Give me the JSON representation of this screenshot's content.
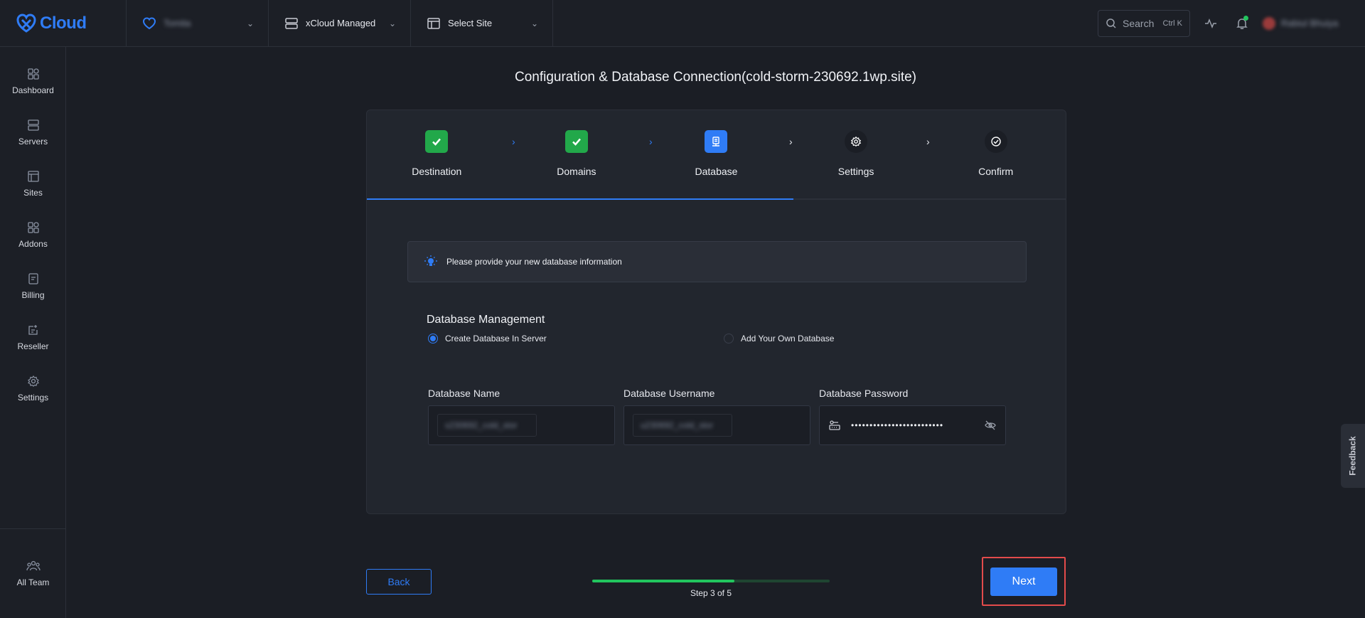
{
  "brand": {
    "logo_text": "Cloud",
    "accent": "#2f7cf6"
  },
  "topbar": {
    "team_crumb": "Tomita",
    "managed_crumb": "xCloud Managed",
    "site_crumb": "Select Site",
    "search_label": "Search",
    "search_shortcut": "Ctrl K",
    "user_name": "Rabiul Bhuiya"
  },
  "sidebar": {
    "items": [
      {
        "label": "Dashboard",
        "icon": "dashboard-icon"
      },
      {
        "label": "Servers",
        "icon": "server-icon"
      },
      {
        "label": "Sites",
        "icon": "sites-icon"
      },
      {
        "label": "Addons",
        "icon": "addons-icon"
      },
      {
        "label": "Billing",
        "icon": "billing-icon"
      },
      {
        "label": "Reseller",
        "icon": "reseller-icon"
      },
      {
        "label": "Settings",
        "icon": "gear-icon"
      }
    ],
    "bottom_label": "All Team"
  },
  "page": {
    "title": "Configuration & Database Connection(cold-storm-230692.1wp.site)"
  },
  "steps": [
    {
      "label": "Destination",
      "state": "done"
    },
    {
      "label": "Domains",
      "state": "done"
    },
    {
      "label": "Database",
      "state": "active"
    },
    {
      "label": "Settings",
      "state": "todo"
    },
    {
      "label": "Confirm",
      "state": "todo"
    }
  ],
  "info": {
    "text": "Please provide your new database information"
  },
  "db_management": {
    "title": "Database Management",
    "option_create": "Create Database In Server",
    "option_own": "Add Your Own Database",
    "selected": "create"
  },
  "fields": {
    "name_label": "Database Name",
    "name_value": "s230692_cold_stor",
    "username_label": "Database Username",
    "username_value": "u230692_cold_stor",
    "password_label": "Database Password",
    "password_value": "•••••••••••••••••••••••••"
  },
  "footer": {
    "back_label": "Back",
    "next_label": "Next",
    "progress_text": "Step 3 of 5",
    "progress_fraction": 0.6
  },
  "feedback_label": "Feedback"
}
